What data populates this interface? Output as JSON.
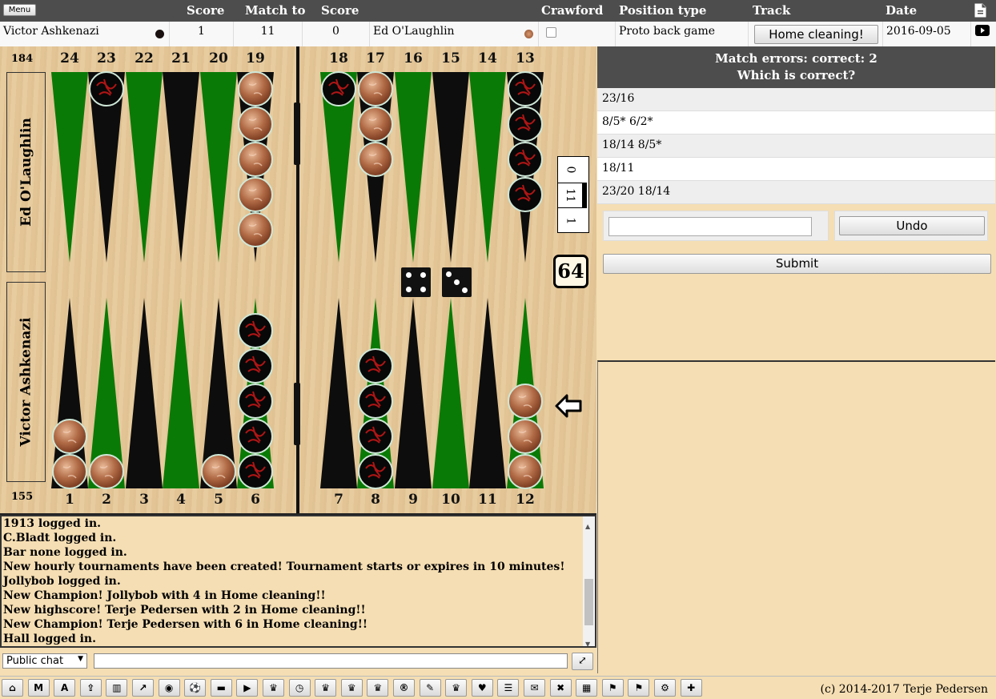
{
  "header": {
    "menu_label": "Menu",
    "score_label": "Score",
    "match_to_label": "Match to",
    "score2_label": "Score",
    "crawford_label": "Crawford",
    "position_type_label": "Position type",
    "track_label": "Track",
    "date_label": "Date"
  },
  "match": {
    "player1": "Victor Ashkenazi",
    "score1": "1",
    "match_to": "11",
    "score2": "0",
    "player2": "Ed O'Laughlin",
    "crawford": false,
    "position_type": "Proto back game",
    "track_button": "Home cleaning!",
    "date": "2016-09-05"
  },
  "board": {
    "top_points": [
      "24",
      "23",
      "22",
      "21",
      "20",
      "19",
      "18",
      "17",
      "16",
      "15",
      "14",
      "13"
    ],
    "bottom_points": [
      "1",
      "2",
      "3",
      "4",
      "5",
      "6",
      "7",
      "8",
      "9",
      "10",
      "11",
      "12"
    ],
    "pip_top": "184",
    "pip_bottom": "155",
    "top_player": "Ed O'Laughlin",
    "bottom_player": "Victor Ashkenazi",
    "cube_value": "64",
    "score_marks": [
      "0",
      "11",
      "1"
    ],
    "dice": [
      4,
      3
    ],
    "checkers": {
      "red_black": {
        "23": 1,
        "18": 1,
        "13": 4,
        "6": 5,
        "8": 4
      },
      "brown": {
        "19": 5,
        "17": 3,
        "1": 2,
        "2": 1,
        "5": 1,
        "12": 3
      }
    },
    "turn_arrow_icon": "arrow-left-icon"
  },
  "panel": {
    "errors_text": "Match errors: correct: 2",
    "question": "Which is correct?",
    "options": [
      "23/16",
      "8/5* 6/2*",
      "18/14 8/5*",
      "18/11",
      "23/20 18/14"
    ],
    "move_input_value": "",
    "undo_label": "Undo",
    "submit_label": "Submit"
  },
  "log": [
    "1913 logged in.",
    "C.Bladt logged in.",
    "Bar none logged in.",
    "New hourly tournaments have been created! Tournament starts or expires in 10 minutes!",
    "Jollybob logged in.",
    "New Champion! Jollybob with 4 in Home cleaning!!",
    "New highscore! Terje Pedersen with 2 in Home cleaning!!",
    "New Champion! Terje Pedersen with 6 in Home cleaning!!",
    "Hall logged in."
  ],
  "chat": {
    "channel": "Public chat",
    "input_value": ""
  },
  "toolbar": {
    "icons": [
      "home-icon",
      "m-button",
      "a-button",
      "upload-icon",
      "bar-chart-icon",
      "line-chart-icon",
      "eye-icon",
      "soccer-ball-icon",
      "archive-icon",
      "play-icon",
      "trophy-icon",
      "clock-icon",
      "trophy-icon",
      "trophy-icon",
      "trophy-icon",
      "registered-icon",
      "edit-icon",
      "trophy-icon",
      "heart-icon",
      "database-icon",
      "chat-icon",
      "close-icon",
      "film-icon",
      "bookmark-icon",
      "bookmark-icon",
      "settings-icon",
      "plus-icon"
    ],
    "letters": {
      "m-button": "M",
      "a-button": "A"
    },
    "copyright": "(c) 2014-2017 Terje Pedersen"
  }
}
